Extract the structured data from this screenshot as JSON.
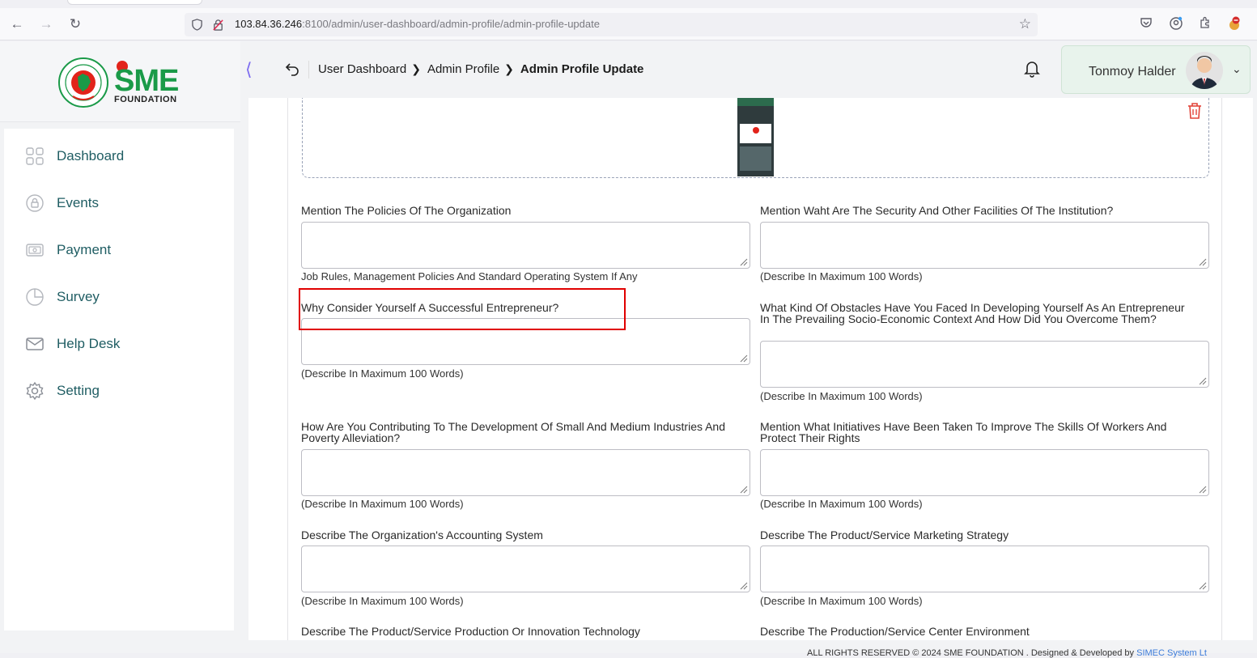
{
  "browser": {
    "url_host": "103.84.36.246",
    "url_rest": ":8100/admin/user-dashboard/admin-profile/admin-profile-update"
  },
  "logo": {
    "word": "SME",
    "sub": "FOUNDATION"
  },
  "sidebar": {
    "items": [
      {
        "label": "Dashboard",
        "icon": "grid-icon"
      },
      {
        "label": "Events",
        "icon": "lock-icon"
      },
      {
        "label": "Payment",
        "icon": "cash-icon"
      },
      {
        "label": "Survey",
        "icon": "pie-chart-icon"
      },
      {
        "label": "Help Desk",
        "icon": "mail-icon"
      },
      {
        "label": "Setting",
        "icon": "gear-icon"
      }
    ]
  },
  "header": {
    "breadcrumb": [
      "User Dashboard",
      "Admin Profile",
      "Admin Profile Update"
    ],
    "user_name": "Tonmoy Halder"
  },
  "form": {
    "fields": [
      {
        "label": "Mention The Policies Of The Organization",
        "hint": "Job Rules, Management Policies And Standard Operating System If Any"
      },
      {
        "label": "Mention Waht Are The Security And Other Facilities Of The Institution?",
        "hint": "(Describe In Maximum 100 Words)"
      },
      {
        "label": "Why Consider Yourself A Successful Entrepreneur?",
        "hint": "(Describe In Maximum 100 Words)"
      },
      {
        "label": "What Kind Of Obstacles Have You Faced In Developing Yourself As An Entrepreneur In The Prevailing Socio-Economic Context And How Did You Overcome Them?",
        "hint": "(Describe In Maximum 100 Words)"
      },
      {
        "label": "How Are You Contributing To The Development Of Small And Medium Industries And Poverty Alleviation?",
        "hint": "(Describe In Maximum 100 Words)"
      },
      {
        "label": "Mention What Initiatives Have Been Taken To Improve The Skills Of Workers And Protect Their Rights",
        "hint": "(Describe In Maximum 100 Words)"
      },
      {
        "label": "Describe The Organization's Accounting System",
        "hint": "(Describe In Maximum 100 Words)"
      },
      {
        "label": "Describe The Product/Service Marketing Strategy",
        "hint": "(Describe In Maximum 100 Words)"
      },
      {
        "label": "Describe The Product/Service Production Or Innovation Technology"
      },
      {
        "label": "Describe The Production/Service Center Environment"
      }
    ]
  },
  "footer": {
    "text": "ALL RIGHTS RESERVED © 2024 SME FOUNDATION . Designed & Developed by ",
    "link": "SIMEC System Lt"
  },
  "colors": {
    "sidebar_text": "#1f5d63",
    "highlight": "#e00000",
    "logo_green": "#1a9a48",
    "logo_red": "#e2231a"
  }
}
